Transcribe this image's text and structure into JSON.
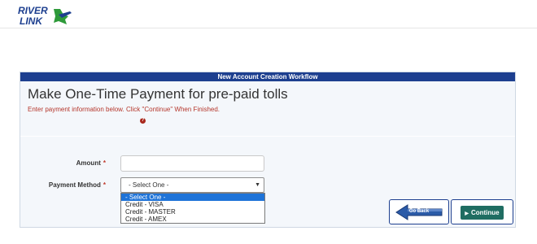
{
  "brand": {
    "logo_line1": "RIVER",
    "logo_line2": "LINK",
    "colors": {
      "navy": "#1d3f8f",
      "green": "#2e9a3a"
    }
  },
  "workflow": {
    "header": "New Account Creation Workflow",
    "title": "Make One-Time Payment for pre-paid tolls",
    "instructions": "Enter payment information below. Click \"Continue\" When Finished.",
    "error_icon": "?"
  },
  "form": {
    "amount_label": "Amount",
    "required_marker": "*",
    "amount_value": "",
    "payment_method_label": "Payment Method",
    "payment_method_selected": "- Select One -",
    "payment_method_options": [
      "- Select One -",
      "Credit - VISA",
      "Credit - MASTER",
      "Credit - AMEX"
    ]
  },
  "actions": {
    "go_back_label": "Go Back",
    "continue_label": "Continue"
  },
  "colors": {
    "panel_header_bg": "#1d3f8f",
    "instructions_text": "#b5362b",
    "continue_bg": "#1f6d62",
    "dropdown_highlight": "#1e73d8"
  }
}
